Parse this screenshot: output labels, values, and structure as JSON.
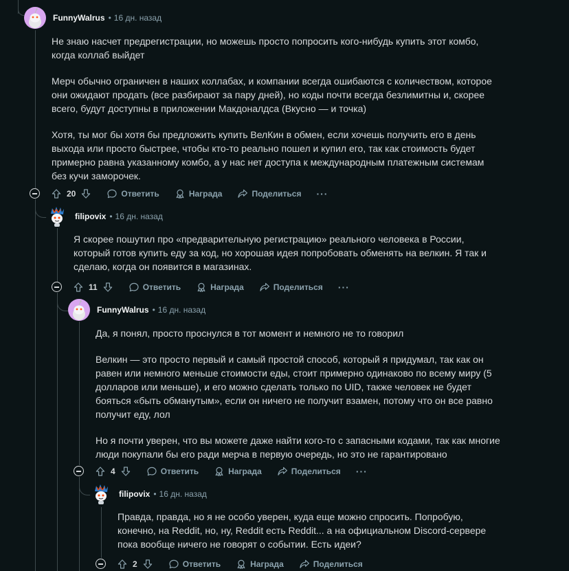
{
  "comments": [
    {
      "author": "FunnyWalrus",
      "time": "16 дн. назад",
      "paragraphs": [
        "Не знаю насчет предрегистрации, но можешь просто попросить кого-нибудь купить этот комбо, когда коллаб выйдет",
        "Мерч обычно ограничен в наших коллабах, и компании всегда ошибаются с количеством, которое они ожидают продать (все разбирают за пару дней), но коды почти всегда безлимитны и, скорее всего, будут доступны в приложении Макдоналдса (Вкусно — и точка)",
        "Хотя, ты мог бы хотя бы предложить купить ВелКин в обмен, если хочешь получить его в день выхода или просто быстрее, чтобы кто-то реально пошел и купил его, так как стоимость будет примерно равна указанному комбо, а у нас нет доступа к международным платежным системам без кучи заморочек."
      ],
      "votes": "20"
    },
    {
      "author": "filipovix",
      "time": "16 дн. назад",
      "paragraphs": [
        "Я скорее пошутил про «предварительную регистрацию» реального человека в России, который готов купить еду за код, но хорошая идея попробовать обменять на велкин. Я так и сделаю, когда он появится в магазинах."
      ],
      "votes": "11"
    },
    {
      "author": "FunnyWalrus",
      "time": "16 дн. назад",
      "paragraphs": [
        "Да, я понял, просто проснулся в тот момент и немного не то говорил",
        "Велкин — это просто первый и самый простой способ, который я придумал, так как он равен или немного меньше стоимости еды, стоит примерно одинаково по всему миру (5 долларов или меньше), и его можно сделать только по UID, также человек не будет бояться «быть обманутым», если он ничего не получит взамен, потому что он все равно получит еду, лол",
        "Но я почти уверен, что вы можете даже найти кого-то с запасными кодами, так как многие люди покупали бы его ради мерча в первую очередь, но это не гарантировано"
      ],
      "votes": "4"
    },
    {
      "author": "filipovix",
      "time": "16 дн. назад",
      "paragraphs": [
        "Правда, правда, но я не особо уверен, куда еще можно спросить. Попробую, конечно, на Reddit, но, ну, Reddit есть Reddit... а на официальном Discord-сервере пока вообще ничего не говорят о событии. Есть идеи?"
      ],
      "votes": "2"
    }
  ],
  "actions": {
    "reply": "Ответить",
    "award": "Награда",
    "share": "Поделиться",
    "more": "···"
  },
  "icons": {
    "upvote": "arrow-up-icon",
    "downvote": "arrow-down-icon",
    "reply": "speech-bubble-icon",
    "award": "award-icon",
    "share": "share-arrow-icon",
    "collapse": "minus-circle-icon"
  },
  "colors": {
    "background": "#0b1416",
    "text": "#d7dadc",
    "meta": "#8ba2ad",
    "thread_line": "#3e4a4d",
    "avatar_walrus": "#d9a6f0"
  }
}
